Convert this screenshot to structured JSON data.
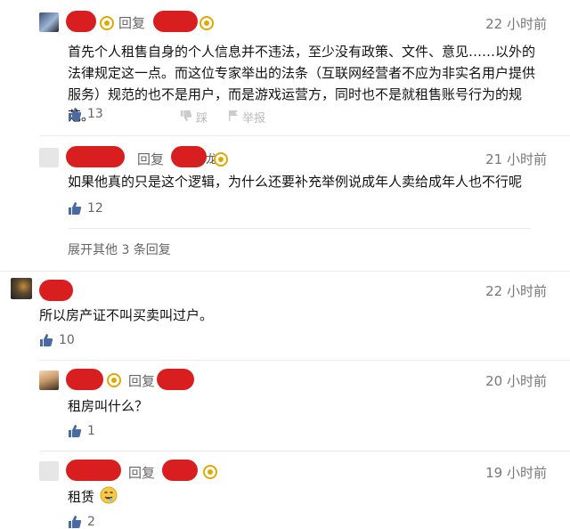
{
  "comments": [
    {
      "reply_word": "回复",
      "time": "22 小时前",
      "body": "首先个人租售自身的个人信息并不违法，至少没有政策、文件、意见……以外的法律规定这一点。而这位专家举出的法条（互联网经营者不应为非实名用户提供服务）规范的也不是用户，而是游戏运营方，同时也不是就租售账号行为的规范。",
      "likes": "13",
      "dislike_label": "踩",
      "report_label": "举报"
    },
    {
      "reply_word": "回复",
      "partial_name": "…龙",
      "time": "21 小时前",
      "body": "如果他真的只是这个逻辑，为什么还要补充举例说成年人卖给成年人也不行呢",
      "likes": "12",
      "expand_label": "展开其他 3 条回复"
    },
    {
      "time": "22 小时前",
      "body": "所以房产证不叫买卖叫过户。",
      "likes": "10"
    },
    {
      "reply_word": "回复",
      "time": "20 小时前",
      "body": "租房叫什么？",
      "likes": "1"
    },
    {
      "reply_word": "回复",
      "time": "19 小时前",
      "body": "租赁",
      "likes": "2"
    }
  ],
  "colors": {
    "redaction": "#d81e1e",
    "badge": "#e0a800",
    "icon": "#4a6aa5"
  },
  "icons": {
    "like": "thumbs-up-icon",
    "dislike": "thumbs-down-icon",
    "report": "flag-icon",
    "emoji": "drooling-face-emoji"
  }
}
